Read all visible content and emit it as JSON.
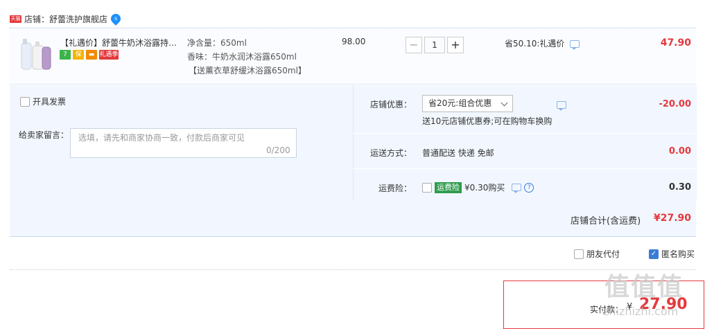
{
  "shop": {
    "badge": "天猫",
    "label": "店铺：舒蕾洗护旗舰店",
    "icon": "water-drop-icon",
    "icon_text": "s"
  },
  "item": {
    "title": "【礼遇价】舒蕾牛奶沐浴露持久留香",
    "tags": [
      {
        "name": "7day-return-tag",
        "text": "7",
        "color": "#3db34b"
      },
      {
        "name": "guarantee-tag",
        "text": "保",
        "color": "#f5b400"
      },
      {
        "name": "card-tag",
        "text": "▬",
        "color": "#f08a00"
      },
      {
        "name": "gift-tag",
        "text": "礼遇季",
        "color": "#e4393c"
      }
    ],
    "spec_volume": "净含量：650ml",
    "spec_scent": "香味：牛奶水润沐浴露650ml",
    "spec_gift": "【送薰衣草舒缓沐浴露650ml】",
    "price": "98.00",
    "qty": "1",
    "minus": "−",
    "plus": "+",
    "promo": "省50.10:礼遇价",
    "total": "47.90"
  },
  "invoice": {
    "label": "开具发票"
  },
  "message": {
    "label": "给卖家留言：",
    "placeholder": "选填，请先和商家协商一致，付款后商家可见",
    "count": "0/200"
  },
  "coupon": {
    "label": "店铺优惠：",
    "selected": "省20元:组合优惠",
    "note": "送10元店铺优惠券;可在购物车换购",
    "value": "-20.00"
  },
  "shipping": {
    "label": "运送方式：",
    "method": "普通配送 快递 免邮",
    "value": "0.00"
  },
  "insurance": {
    "label": "运费险：",
    "tag": "运费险",
    "text": "¥0.30购买",
    "value": "0.30"
  },
  "shop_total": {
    "label": "店铺合计(含运费)",
    "value": "¥27.90"
  },
  "options": {
    "friend_pay": "朋友代付",
    "anonymous": "匿名购买"
  },
  "pay": {
    "label": "实付款：",
    "currency": "¥",
    "value": "27.90"
  },
  "watermark": {
    "text": "值值值",
    "sub": "zhizhizhi.com"
  }
}
